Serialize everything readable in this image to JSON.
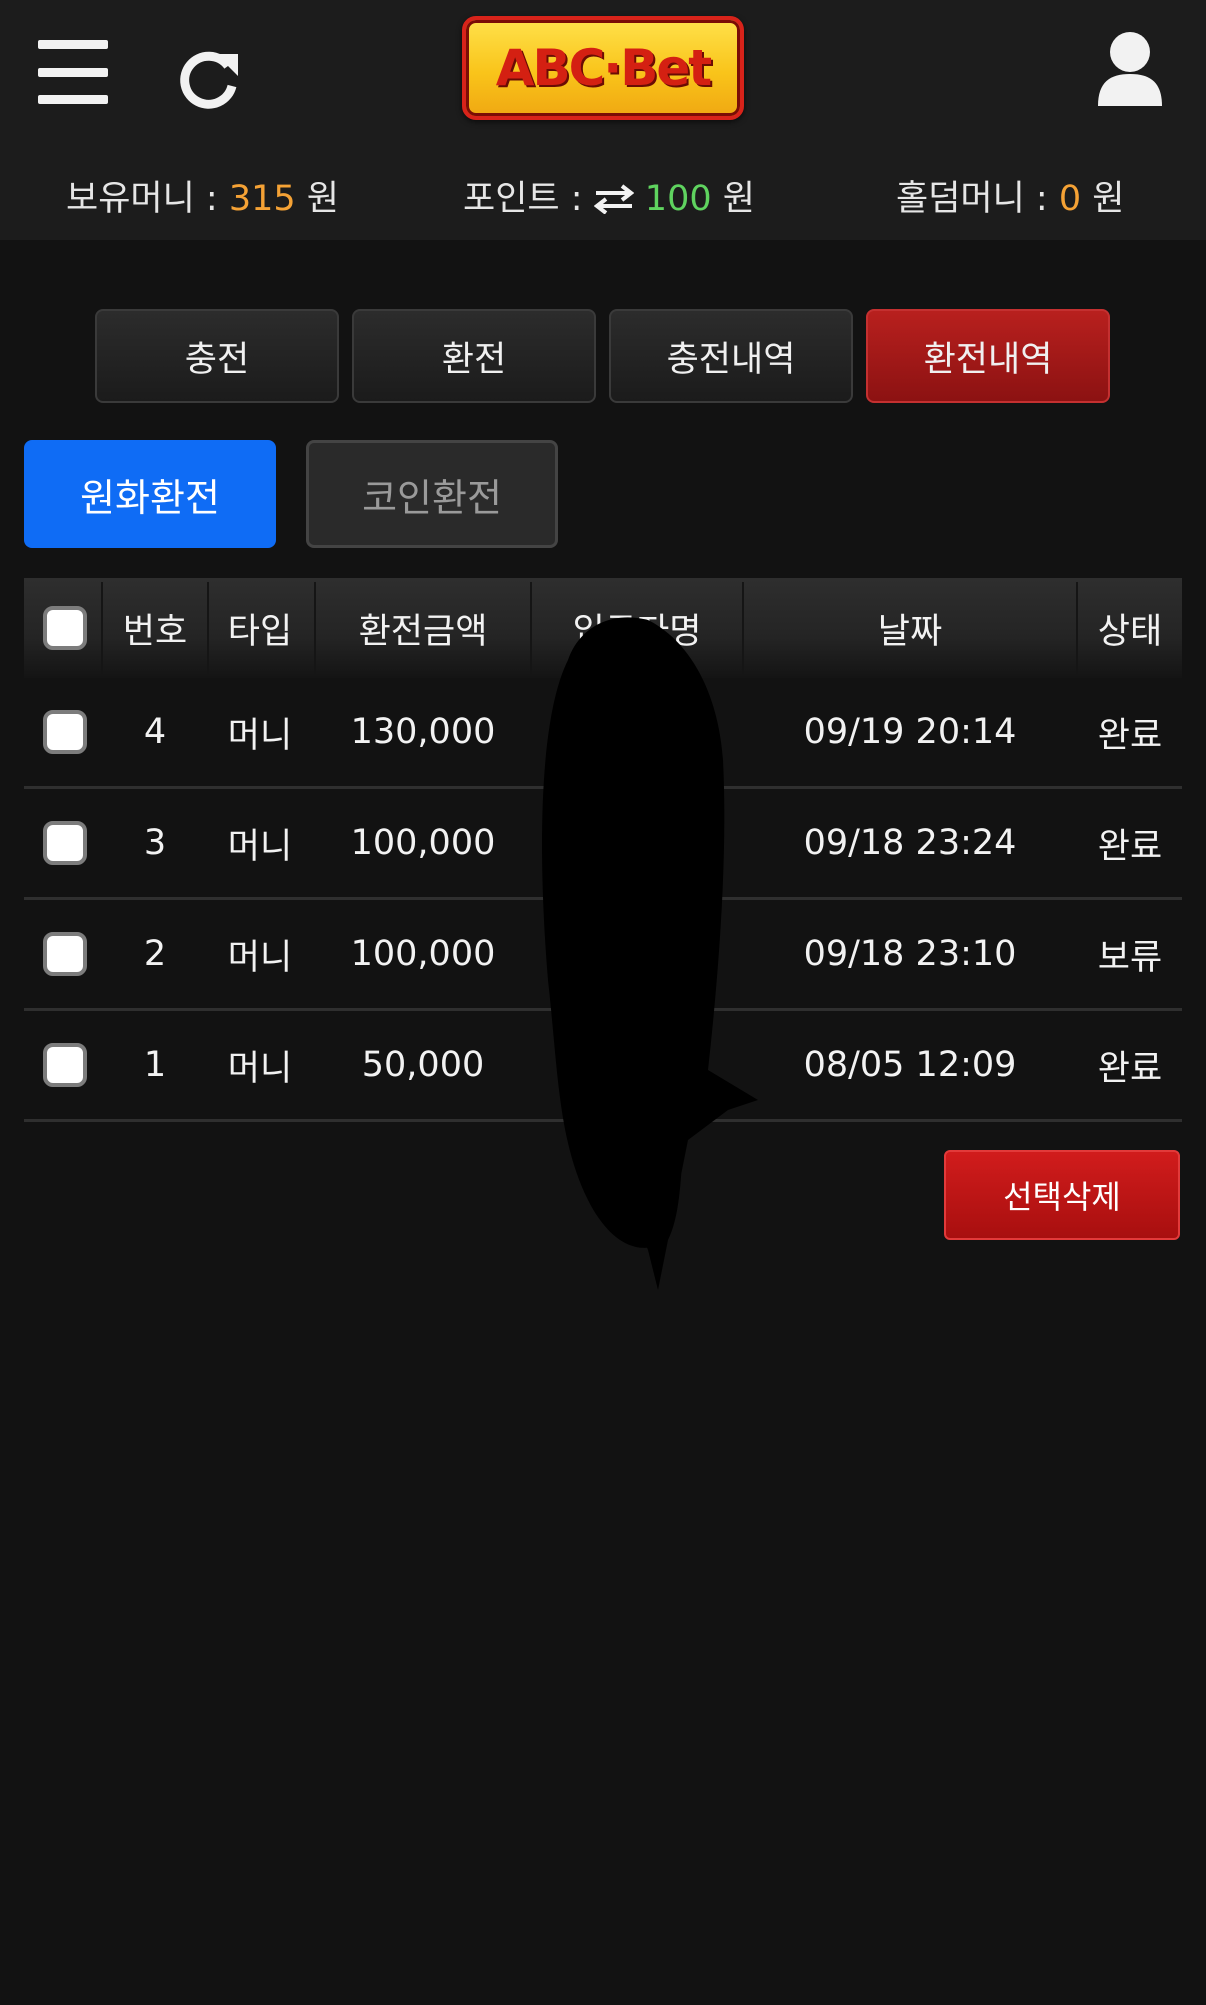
{
  "header": {
    "logo_text": "ABC·Bet",
    "icons": {
      "menu": "hamburger-menu-icon",
      "refresh": "refresh-icon",
      "user": "user-profile-icon"
    }
  },
  "balances": {
    "money_label": "보유머니 : ",
    "money_value": "315",
    "points_label": "포인트 : ",
    "points_value": "100",
    "holding_label": "홀덤머니 : ",
    "holding_value": "0",
    "unit": "원"
  },
  "tabs": [
    {
      "label": "충전",
      "active": false
    },
    {
      "label": "환전",
      "active": false
    },
    {
      "label": "충전내역",
      "active": false
    },
    {
      "label": "환전내역",
      "active": true
    }
  ],
  "subtabs": [
    {
      "label": "원화환전",
      "active": true
    },
    {
      "label": "코인환전",
      "active": false
    }
  ],
  "table": {
    "headers": [
      "번호",
      "타입",
      "환전금액",
      "입금자명",
      "날짜",
      "상태"
    ],
    "rows": [
      {
        "no": "4",
        "type": "머니",
        "amount": "130,000",
        "depositor": "",
        "date": "09/19 20:14",
        "status": "완료"
      },
      {
        "no": "3",
        "type": "머니",
        "amount": "100,000",
        "depositor": "",
        "date": "09/18 23:24",
        "status": "완료"
      },
      {
        "no": "2",
        "type": "머니",
        "amount": "100,000",
        "depositor": "",
        "date": "09/18 23:10",
        "status": "보류"
      },
      {
        "no": "1",
        "type": "머니",
        "amount": "50,000",
        "depositor": "",
        "date": "08/05 12:09",
        "status": "완료"
      }
    ]
  },
  "actions": {
    "delete_selected": "선택삭제"
  },
  "colors": {
    "accent_orange": "#f5a235",
    "accent_green": "#5fd35f",
    "active_red": "#a81818",
    "active_blue": "#0f6cf5"
  }
}
